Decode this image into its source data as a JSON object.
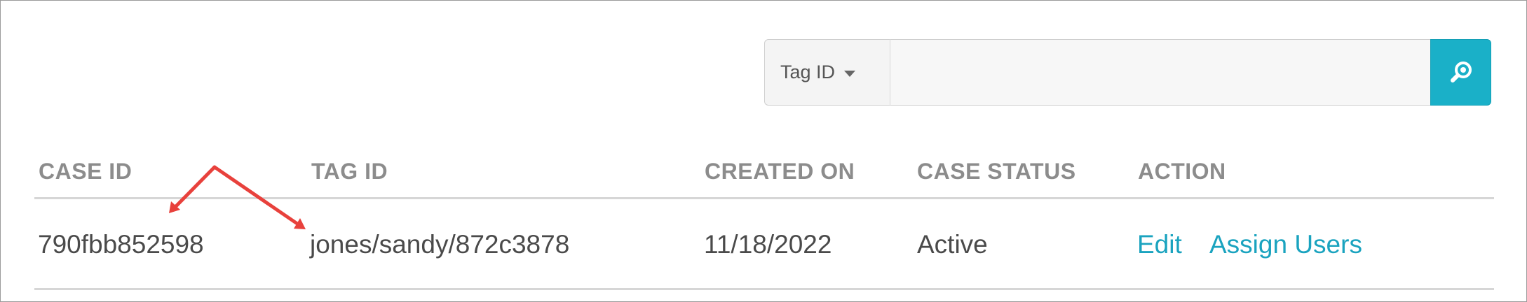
{
  "search": {
    "filter_label": "Tag ID",
    "input_value": "",
    "search_icon": "search-icon"
  },
  "table": {
    "headers": [
      "CASE ID",
      "TAG ID",
      "CREATED ON",
      "CASE STATUS",
      "ACTION"
    ],
    "rows": [
      {
        "case_id": "790fbb852598",
        "tag_id": "jones/sandy/872c3878",
        "created_on": "11/18/2022",
        "case_status": "Active",
        "actions": {
          "edit": "Edit",
          "assign_users": "Assign Users"
        }
      }
    ]
  },
  "colors": {
    "accent": "#1ab0c8",
    "link": "#1aa3bf",
    "annotation_arrow": "#e8413c",
    "header_text": "#8c8c8c",
    "body_text": "#4a4a4a"
  }
}
